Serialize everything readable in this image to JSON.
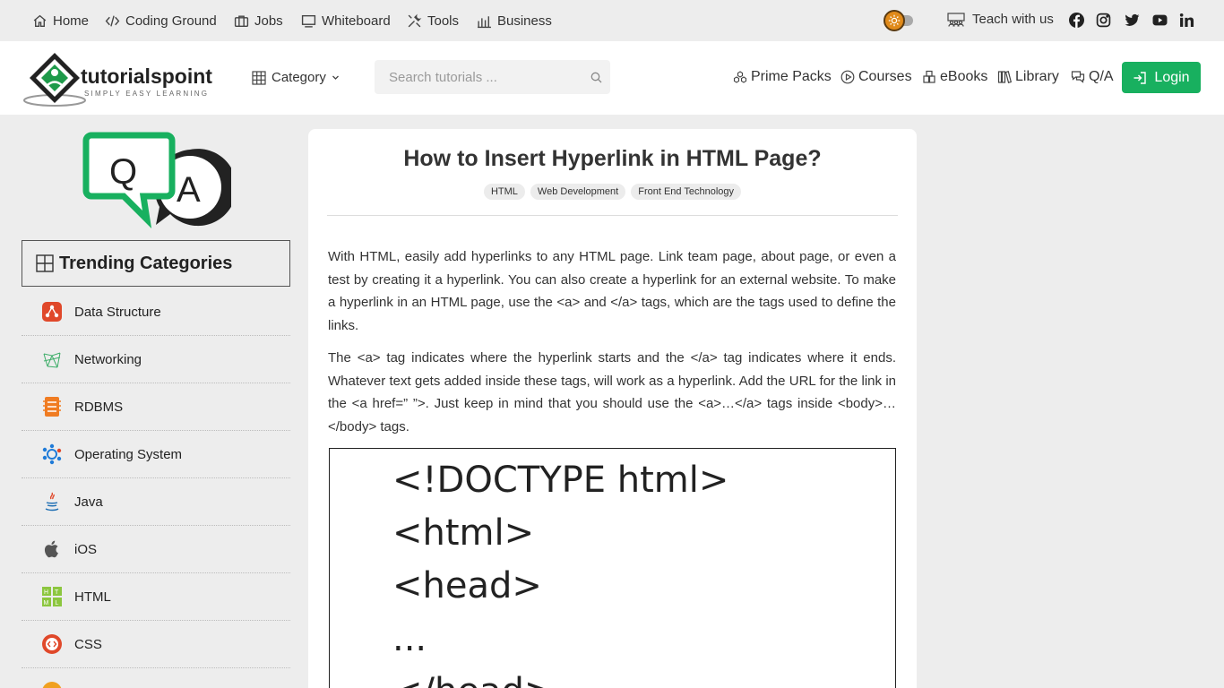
{
  "topbar": {
    "nav": [
      {
        "label": "Home",
        "icon": "home-icon"
      },
      {
        "label": "Coding Ground",
        "icon": "code-icon"
      },
      {
        "label": "Jobs",
        "icon": "briefcase-icon"
      },
      {
        "label": "Whiteboard",
        "icon": "whiteboard-icon"
      },
      {
        "label": "Tools",
        "icon": "tools-icon"
      },
      {
        "label": "Business",
        "icon": "chart-icon"
      }
    ],
    "teach_label": "Teach with us",
    "social": [
      "facebook-icon",
      "instagram-icon",
      "twitter-icon",
      "youtube-icon",
      "linkedin-icon"
    ]
  },
  "header": {
    "logo_text": "tutorialspoint",
    "logo_tagline": "SIMPLY EASY LEARNING",
    "category_label": "Category",
    "search_placeholder": "Search tutorials ...",
    "nav": [
      {
        "label": "Prime Packs",
        "icon": "prime-icon"
      },
      {
        "label": "Courses",
        "icon": "play-icon"
      },
      {
        "label": "eBooks",
        "icon": "box-icon"
      },
      {
        "label": "Library",
        "icon": "library-icon"
      },
      {
        "label": "Q/A",
        "icon": "chat-icon"
      }
    ],
    "login_label": "Login"
  },
  "sidebar": {
    "trending_title": "Trending Categories",
    "categories": [
      {
        "label": "Data Structure",
        "icon": "data-structure-icon"
      },
      {
        "label": "Networking",
        "icon": "networking-icon"
      },
      {
        "label": "RDBMS",
        "icon": "rdbms-icon"
      },
      {
        "label": "Operating System",
        "icon": "os-icon"
      },
      {
        "label": "Java",
        "icon": "java-icon"
      },
      {
        "label": "iOS",
        "icon": "apple-icon"
      },
      {
        "label": "HTML",
        "icon": "html-icon"
      },
      {
        "label": "CSS",
        "icon": "css-icon"
      }
    ]
  },
  "article": {
    "title": "How to Insert Hyperlink in HTML Page?",
    "tags": [
      "HTML",
      "Web Development",
      "Front End Technology"
    ],
    "paragraphs": [
      "With HTML, easily add hyperlinks to any HTML page. Link team page, about page, or even a test by creating it a hyperlink. You can also create a hyperlink for an external website. To make a hyperlink in an HTML page, use the <a> and </a> tags, which are the tags used to define the links.",
      "The <a> tag indicates where the hyperlink starts and the </a> tag indicates where it ends. Whatever text gets added inside these tags, will work as a hyperlink. Add the URL for the link in the <a href=” ”>. Just keep in mind that you should use the <a>…</a> tags inside <body>…</body> tags."
    ],
    "code_lines": [
      "<!DOCTYPE html>",
      "<html>",
      "<head>",
      "...",
      "</head>"
    ]
  },
  "colors": {
    "accent_green": "#18b05f",
    "toggle_orange": "#e08a1a"
  }
}
